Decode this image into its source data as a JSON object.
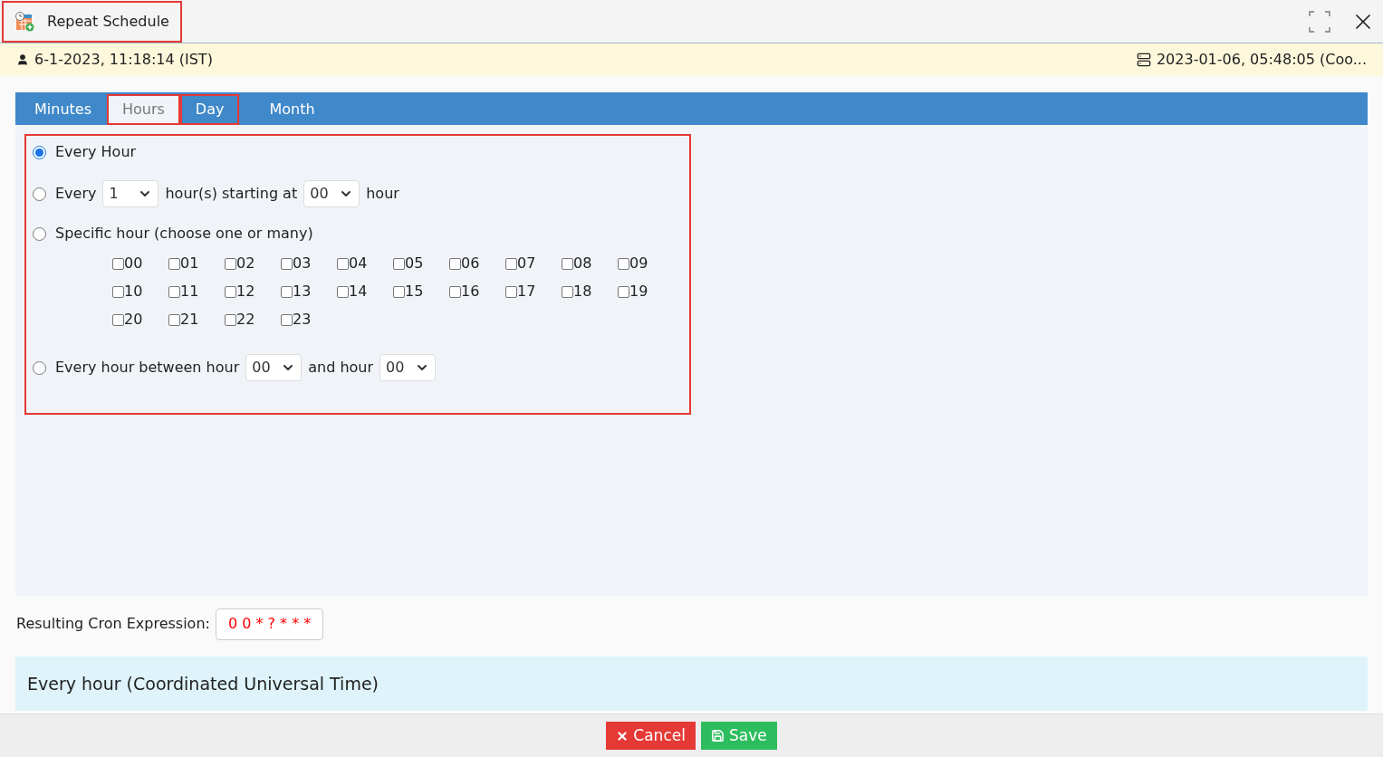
{
  "window": {
    "title": "Repeat Schedule",
    "highlighted": true
  },
  "info_bar": {
    "local_time": "6-1-2023, 11:18:14 (IST)",
    "server_time": "2023-01-06, 05:48:05 (Coo..."
  },
  "tabs": [
    {
      "label": "Minutes",
      "selected": false,
      "highlighted": false
    },
    {
      "label": "Hours",
      "selected": true,
      "highlighted": true
    },
    {
      "label": "Day",
      "selected": false,
      "highlighted": true
    },
    {
      "label": "Month",
      "selected": false,
      "highlighted": false
    }
  ],
  "panel": {
    "highlighted": true,
    "every_hour": {
      "label": "Every Hour",
      "selected": true
    },
    "every_n": {
      "selected": false,
      "prefix": "Every",
      "interval": "1",
      "middle": "hour(s) starting at",
      "start": "00",
      "suffix": "hour"
    },
    "specific": {
      "selected": false,
      "label": "Specific hour (choose one or many)",
      "hours": [
        {
          "label": "00",
          "checked": false
        },
        {
          "label": "01",
          "checked": false
        },
        {
          "label": "02",
          "checked": false
        },
        {
          "label": "03",
          "checked": false
        },
        {
          "label": "04",
          "checked": false
        },
        {
          "label": "05",
          "checked": false
        },
        {
          "label": "06",
          "checked": false
        },
        {
          "label": "07",
          "checked": false
        },
        {
          "label": "08",
          "checked": false
        },
        {
          "label": "09",
          "checked": false
        },
        {
          "label": "10",
          "checked": false
        },
        {
          "label": "11",
          "checked": false
        },
        {
          "label": "12",
          "checked": false
        },
        {
          "label": "13",
          "checked": false
        },
        {
          "label": "14",
          "checked": false
        },
        {
          "label": "15",
          "checked": false
        },
        {
          "label": "16",
          "checked": false
        },
        {
          "label": "17",
          "checked": false
        },
        {
          "label": "18",
          "checked": false
        },
        {
          "label": "19",
          "checked": false
        },
        {
          "label": "20",
          "checked": false
        },
        {
          "label": "21",
          "checked": false
        },
        {
          "label": "22",
          "checked": false
        },
        {
          "label": "23",
          "checked": false
        }
      ]
    },
    "between": {
      "selected": false,
      "prefix": "Every hour between hour",
      "from": "00",
      "middle": "and hour",
      "to": "00"
    }
  },
  "cron": {
    "label": "Resulting Cron Expression:",
    "value": "0 0 * ? * * *"
  },
  "description": "Every hour (Coordinated Universal Time)",
  "buttons": [
    {
      "kind": "cancel",
      "label": "Cancel"
    },
    {
      "kind": "save",
      "label": "Save"
    }
  ]
}
